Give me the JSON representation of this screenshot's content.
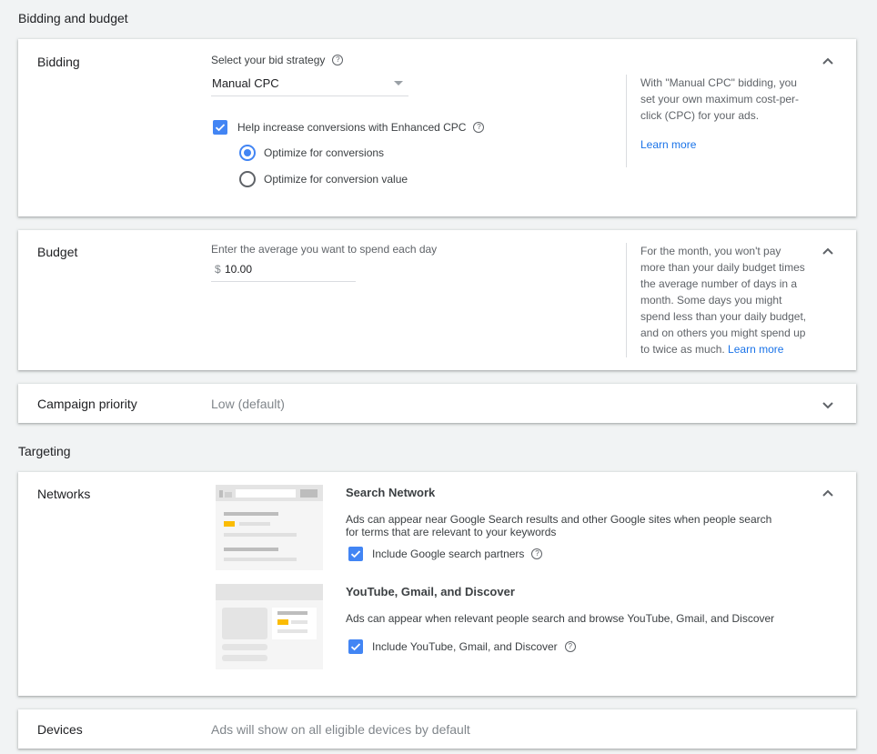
{
  "sections": {
    "bidding_budget": "Bidding and budget",
    "targeting": "Targeting"
  },
  "bidding": {
    "label": "Bidding",
    "strategy_label": "Select your bid strategy",
    "strategy_value": "Manual CPC",
    "enhanced_cpc_label": "Help increase conversions with Enhanced CPC",
    "enhanced_cpc_checked": true,
    "options": [
      {
        "label": "Optimize for conversions",
        "selected": true
      },
      {
        "label": "Optimize for conversion value",
        "selected": false
      }
    ],
    "info": "With \"Manual CPC\" bidding, you set your own maximum cost-per-click (CPC) for your ads.",
    "learn_more": "Learn more"
  },
  "budget": {
    "label": "Budget",
    "prompt": "Enter the average you want to spend each day",
    "currency": "$",
    "value": "10.00",
    "info": "For the month, you won't pay more than your daily budget times the average number of days in a month. Some days you might spend less than your daily budget, and on others you might spend up to twice as much.",
    "learn_more": "Learn more"
  },
  "priority": {
    "label": "Campaign priority",
    "value": "Low (default)"
  },
  "networks": {
    "label": "Networks",
    "search": {
      "title": "Search Network",
      "desc": "Ads can appear near Google Search results and other Google sites when people search for terms that are relevant to your keywords",
      "checkbox_label": "Include Google search partners",
      "checked": true
    },
    "display": {
      "title": "YouTube, Gmail, and Discover",
      "desc": "Ads can appear when relevant people search and browse YouTube, Gmail, and Discover",
      "checkbox_label": "Include YouTube, Gmail, and Discover",
      "checked": true
    }
  },
  "devices": {
    "label": "Devices",
    "value": "Ads will show on all eligible devices by default"
  },
  "colors": {
    "accent": "#4285f4",
    "link": "#1a73e8",
    "highlight": "#fbbc04"
  }
}
